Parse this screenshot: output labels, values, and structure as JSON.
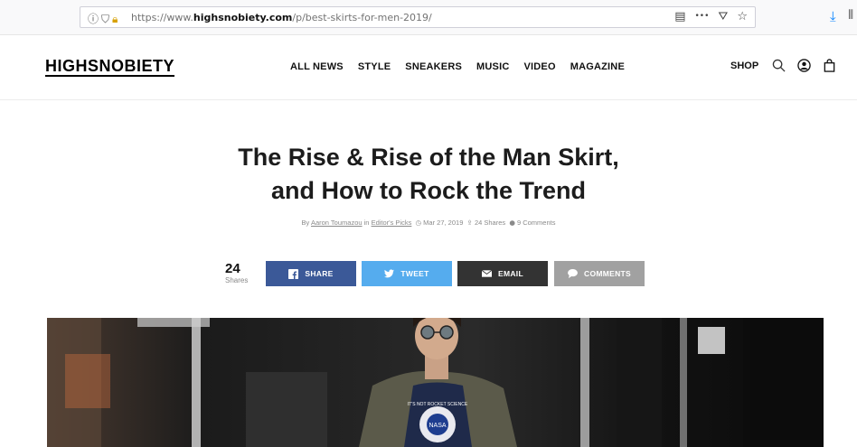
{
  "browser": {
    "url_prefix": "https://www.",
    "url_domain": "highsnobiety.com",
    "url_path": "/p/best-skirts-for-men-2019/",
    "toolbar_icons": [
      "info-icon",
      "shield-icon",
      "lock-warning-icon"
    ],
    "right_icons": [
      "reader-view-icon",
      "more-icon",
      "pocket-icon",
      "bookmark-star-icon"
    ],
    "more_glyph": "•••"
  },
  "header": {
    "logo": "HIGHSNOBIETY",
    "nav": [
      "ALL NEWS",
      "STYLE",
      "SNEAKERS",
      "MUSIC",
      "VIDEO",
      "MAGAZINE"
    ],
    "shop": "SHOP"
  },
  "article": {
    "title_line1": "The Rise & Rise of the Man Skirt,",
    "title_line2": "and How to Rock the Trend",
    "byline": {
      "by": "By",
      "author": "Aaron Toumazou",
      "in": "in",
      "category": "Editor's Picks",
      "date": "Mar 27, 2019",
      "shares": "24 Shares",
      "comments": "9 Comments"
    }
  },
  "share": {
    "count": "24",
    "count_label": "Shares",
    "buttons": {
      "facebook": "SHARE",
      "twitter": "TWEET",
      "email": "EMAIL",
      "comments": "COMMENTS"
    },
    "colors": {
      "facebook": "#3b5998",
      "twitter": "#55acee",
      "email": "#333333",
      "comments": "#a1a1a1"
    }
  },
  "hero": {
    "shirt_text": "IT'S NOT ROCKET SCIENCE",
    "badge": "NASA"
  }
}
